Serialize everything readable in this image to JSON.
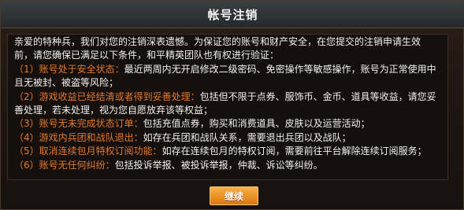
{
  "dialog": {
    "title": "帐号注销",
    "intro": "亲爱的特种兵，我们对您的注销深表遗憾。为保证您的账号和财产安全，在您提交的注销申请生效前，请您确保已满足以下条件，和平精英团队也有权进行验证：",
    "items": [
      {
        "label": "（1）账号处于安全状态：",
        "text": "最近两周内无开启修改二级密码、免密操作等敏感操作，账号为正常使用中且无被封、被盗等风险；"
      },
      {
        "label": "（2）游戏收益已经结清或者得到妥善处理：",
        "text": "包括但不限于点券、服饰币、金币、道具等收益，请您妥善处理，若未处理，视为您自愿放弃该等权益；"
      },
      {
        "label": "（3）账号无未完成状态订单：",
        "text": "包括充值点券，购买和消费道具、皮肤以及运营活动；"
      },
      {
        "label": "（4）游戏内兵团和战队退出：",
        "text": "如存在兵团和战队关系，需要退出兵团以及战队；"
      },
      {
        "label": "（5）取消连续包月特权订阅功能：",
        "text": "如存在连续包月的特权订阅，需要前往平台解除连续订阅服务；"
      },
      {
        "label": "（6）账号无任何纠纷：",
        "text": "包括投诉举报、被投诉举报，仲裁、诉讼等纠纷。"
      }
    ],
    "continue_label": "继续"
  },
  "colors": {
    "highlight": "#e47a2b",
    "button": "#e98e21",
    "text": "#f1f1f1"
  }
}
